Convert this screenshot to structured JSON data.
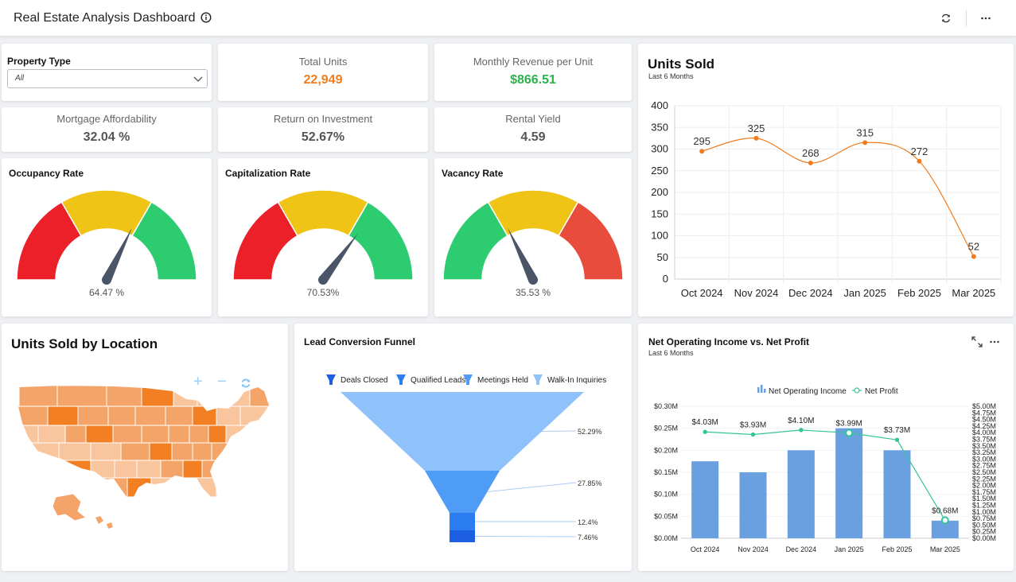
{
  "header": {
    "title": "Real Estate Analysis Dashboard"
  },
  "filter": {
    "label": "Property Type",
    "value": "All"
  },
  "kpis": [
    {
      "label": "Total Units",
      "value": "22,949",
      "color": "#f07c1d"
    },
    {
      "label": "Monthly Revenue per Unit",
      "value": "$866.51",
      "color": "#2bb34a"
    },
    {
      "label": "Mortgage Affordability",
      "value": "32.04 %",
      "color": "#555555"
    },
    {
      "label": "Return on Investment",
      "value": "52.67%",
      "color": "#555555"
    },
    {
      "label": "Rental Yield",
      "value": "4.59",
      "color": "#555555"
    }
  ],
  "gauges": [
    {
      "title": "Occupancy Rate",
      "value": 64.47,
      "label": "64.47 %",
      "bands": [
        "#ec2029",
        "#f0c416",
        "#2ecc71"
      ]
    },
    {
      "title": "Capitalization Rate",
      "value": 70.53,
      "label": "70.53%",
      "bands": [
        "#ec2029",
        "#f0c416",
        "#2ecc71"
      ]
    },
    {
      "title": "Vacancy Rate",
      "value": 35.53,
      "label": "35.53 %",
      "bands": [
        "#2ecc71",
        "#f0c416",
        "#e74c3c"
      ]
    }
  ],
  "units_sold": {
    "title": "Units Sold",
    "subtitle": "Last 6 Months",
    "chart_data": {
      "type": "line",
      "title": "Units Sold",
      "subtitle": "Last 6 Months",
      "categories": [
        "Oct 2024",
        "Nov 2024",
        "Dec 2024",
        "Jan 2025",
        "Feb 2025",
        "Mar 2025"
      ],
      "values": [
        295,
        325,
        268,
        315,
        272,
        52
      ],
      "yticks": [
        0,
        50,
        100,
        150,
        200,
        250,
        300,
        350,
        400
      ],
      "ylim": [
        0,
        400
      ],
      "grid": true,
      "color": "#f07c1d"
    }
  },
  "location": {
    "title": "Units Sold by Location",
    "controls": {
      "zoom_in": "+",
      "zoom_out": "−"
    }
  },
  "funnel": {
    "title": "Lead Conversion Funnel",
    "chart_data": {
      "type": "funnel",
      "stages": [
        {
          "name": "Walk-In Inquiries",
          "value": 52.29,
          "label": "52.29%",
          "color": "#8fc1fb"
        },
        {
          "name": "Meetings Held",
          "value": 27.85,
          "label": "27.85%",
          "color": "#4f9cf6"
        },
        {
          "name": "Qualified Leads",
          "value": 12.4,
          "label": "12.4%",
          "color": "#2c7ef0"
        },
        {
          "name": "Deals Closed",
          "value": 7.46,
          "label": "7.46%",
          "color": "#1c5fe3"
        }
      ],
      "legend": [
        "Deals Closed",
        "Qualified Leads",
        "Meetings Held",
        "Walk-In Inquiries"
      ]
    }
  },
  "noi": {
    "title": "Net Operating Income vs. Net Profit",
    "subtitle": "Last 6 Months",
    "chart_data": {
      "type": "bar",
      "categories": [
        "Oct 2024",
        "Nov 2024",
        "Dec 2024",
        "Jan 2025",
        "Feb 2025",
        "Mar 2025"
      ],
      "series": [
        {
          "name": "Net Operating Income",
          "type": "bar",
          "values": [
            0.175,
            0.15,
            0.2,
            0.25,
            0.2,
            0.04
          ],
          "color": "#6a9fe0"
        },
        {
          "name": "Net Profit",
          "type": "line",
          "values": [
            4.03,
            3.93,
            4.1,
            3.99,
            3.73,
            0.68
          ],
          "labels": [
            "$4.03M",
            "$3.93M",
            "$4.10M",
            "$3.99M",
            "$3.73M",
            "$0.68M"
          ],
          "color": "#35c49a"
        }
      ],
      "yticks_left": [
        "$0.00M",
        "$0.05M",
        "$0.10M",
        "$0.15M",
        "$0.20M",
        "$0.25M",
        "$0.30M"
      ],
      "ylim_left": [
        0,
        0.3
      ],
      "yticks_right": [
        "$0.00M",
        "$0.25M",
        "$0.50M",
        "$0.75M",
        "$1.00M",
        "$1.25M",
        "$1.50M",
        "$1.75M",
        "$2.00M",
        "$2.25M",
        "$2.50M",
        "$2.75M",
        "$3.00M",
        "$3.25M",
        "$3.50M",
        "$3.75M",
        "$4.00M",
        "$4.25M",
        "$4.50M",
        "$4.75M",
        "$5.00M"
      ],
      "ylim_right": [
        0,
        5
      ],
      "legend": [
        "Net Operating Income",
        "Net Profit"
      ]
    }
  },
  "colors": {
    "map_dark": "#f27f22",
    "map_mid": "#f5a469",
    "map_light": "#f9c59d"
  }
}
